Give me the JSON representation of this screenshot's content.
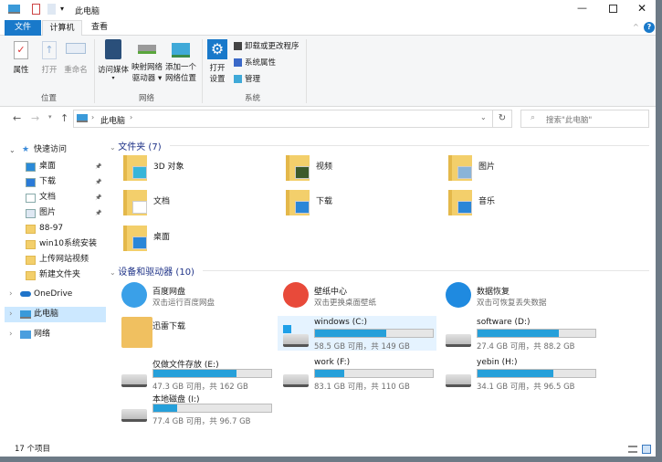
{
  "window": {
    "title": "此电脑",
    "controls": [
      "minimize",
      "maximize",
      "close"
    ]
  },
  "tabs": [
    {
      "label": "文件"
    },
    {
      "label": "计算机"
    },
    {
      "label": "查看"
    }
  ],
  "ribbon": {
    "location": {
      "label": "位置",
      "buttons": [
        {
          "label": "属性",
          "icon": "properties-icon"
        },
        {
          "label": "打开",
          "icon": "open-icon"
        },
        {
          "label": "重命名",
          "icon": "rename-icon"
        }
      ]
    },
    "network": {
      "label": "网络",
      "buttons": [
        {
          "label": "访问媒体",
          "icon": "media-icon"
        },
        {
          "label1": "映射网络",
          "label2": "驱动器 ▾",
          "icon": "map-drive-icon"
        },
        {
          "label1": "添加一个",
          "label2": "网络位置",
          "icon": "network-location-icon"
        }
      ]
    },
    "system": {
      "label": "系统",
      "open_settings1": "打开",
      "open_settings2": "设置",
      "small": [
        {
          "label": "卸载或更改程序"
        },
        {
          "label": "系统属性"
        },
        {
          "label": "管理"
        }
      ]
    }
  },
  "address": {
    "path": "此电脑",
    "search_placeholder": "搜索\"此电脑\""
  },
  "nav": {
    "quick_access": "快速访问",
    "items": [
      {
        "label": "桌面",
        "pinned": true
      },
      {
        "label": "下载",
        "pinned": true
      },
      {
        "label": "文档",
        "pinned": true
      },
      {
        "label": "图片",
        "pinned": true
      },
      {
        "label": "88-97"
      },
      {
        "label": "win10系统安装"
      },
      {
        "label": "上传网站视频"
      },
      {
        "label": "新建文件夹"
      }
    ],
    "onedrive": "OneDrive",
    "this_pc": "此电脑",
    "network": "网络"
  },
  "folders": {
    "header": "文件夹 (7)",
    "items": [
      {
        "label": "3D 对象"
      },
      {
        "label": "视频"
      },
      {
        "label": "图片"
      },
      {
        "label": "文档"
      },
      {
        "label": "下载"
      },
      {
        "label": "音乐"
      },
      {
        "label": "桌面"
      }
    ]
  },
  "devices": {
    "header": "设备和驱动器 (10)",
    "apps": [
      {
        "label": "百度网盘",
        "sub": "双击运行百度网盘"
      },
      {
        "label": "壁纸中心",
        "sub": "双击更换桌面壁纸"
      },
      {
        "label": "数据恢复",
        "sub": "双击可恢复丢失数据"
      },
      {
        "label": "迅雷下载"
      }
    ],
    "drives": [
      {
        "label": "windows (C:)",
        "info": "58.5 GB 可用，共 149 GB",
        "used_fraction": 0.607
      },
      {
        "label": "software (D:)",
        "info": "27.4 GB 可用，共 88.2 GB",
        "used_fraction": 0.689
      },
      {
        "label": "仅做文件存放 (E:)",
        "info": "47.3 GB 可用，共 162 GB",
        "used_fraction": 0.708
      },
      {
        "label": "work (F:)",
        "info": "83.1 GB 可用，共 110 GB",
        "used_fraction": 0.245
      },
      {
        "label": "yebin (H:)",
        "info": "34.1 GB 可用，共 96.5 GB",
        "used_fraction": 0.647
      },
      {
        "label": "本地磁盘 (I:)",
        "info": "77.4 GB 可用，共 96.7 GB",
        "used_fraction": 0.2
      }
    ]
  },
  "status": {
    "count": "17 个项目"
  },
  "colors": {
    "accent": "#1979ca",
    "bar": "#26a0da",
    "selected": "#cce8ff"
  }
}
